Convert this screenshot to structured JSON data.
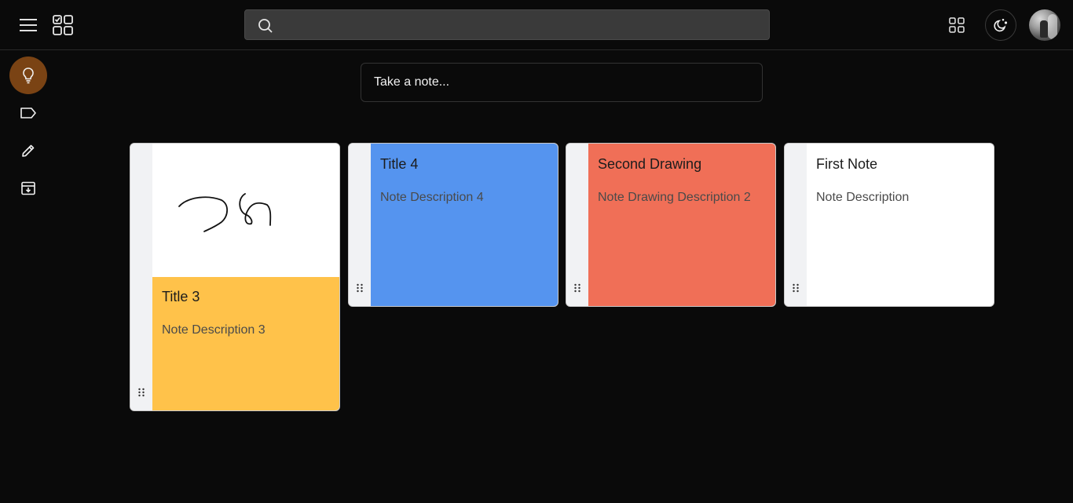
{
  "header": {
    "search": {
      "placeholder": "",
      "value": ""
    },
    "icons": [
      "menu-icon",
      "app-logo-icon",
      "apps-grid-icon",
      "moon-theme-icon"
    ]
  },
  "sidebar": {
    "items": [
      {
        "id": "notes",
        "icon": "lightbulb-icon",
        "active": true
      },
      {
        "id": "labels",
        "icon": "label-icon",
        "active": false
      },
      {
        "id": "edit",
        "icon": "pencil-icon",
        "active": false
      },
      {
        "id": "archive",
        "icon": "archive-icon",
        "active": false
      }
    ]
  },
  "composer": {
    "placeholder": "Take a note..."
  },
  "notes": [
    {
      "title": "Title 3",
      "description": "Note Description 3",
      "color": "#ffc24a",
      "has_drawing": true
    },
    {
      "title": "Title 4",
      "description": "Note Description 4",
      "color": "#5594ef"
    },
    {
      "title": "Second Drawing",
      "description": "Note Drawing Description 2",
      "color": "#f06f57"
    },
    {
      "title": "First Note",
      "description": "Note Description",
      "color": "#ffffff"
    }
  ],
  "colors": {
    "background": "#0a0a0a",
    "active_nav": "#7a4314"
  }
}
